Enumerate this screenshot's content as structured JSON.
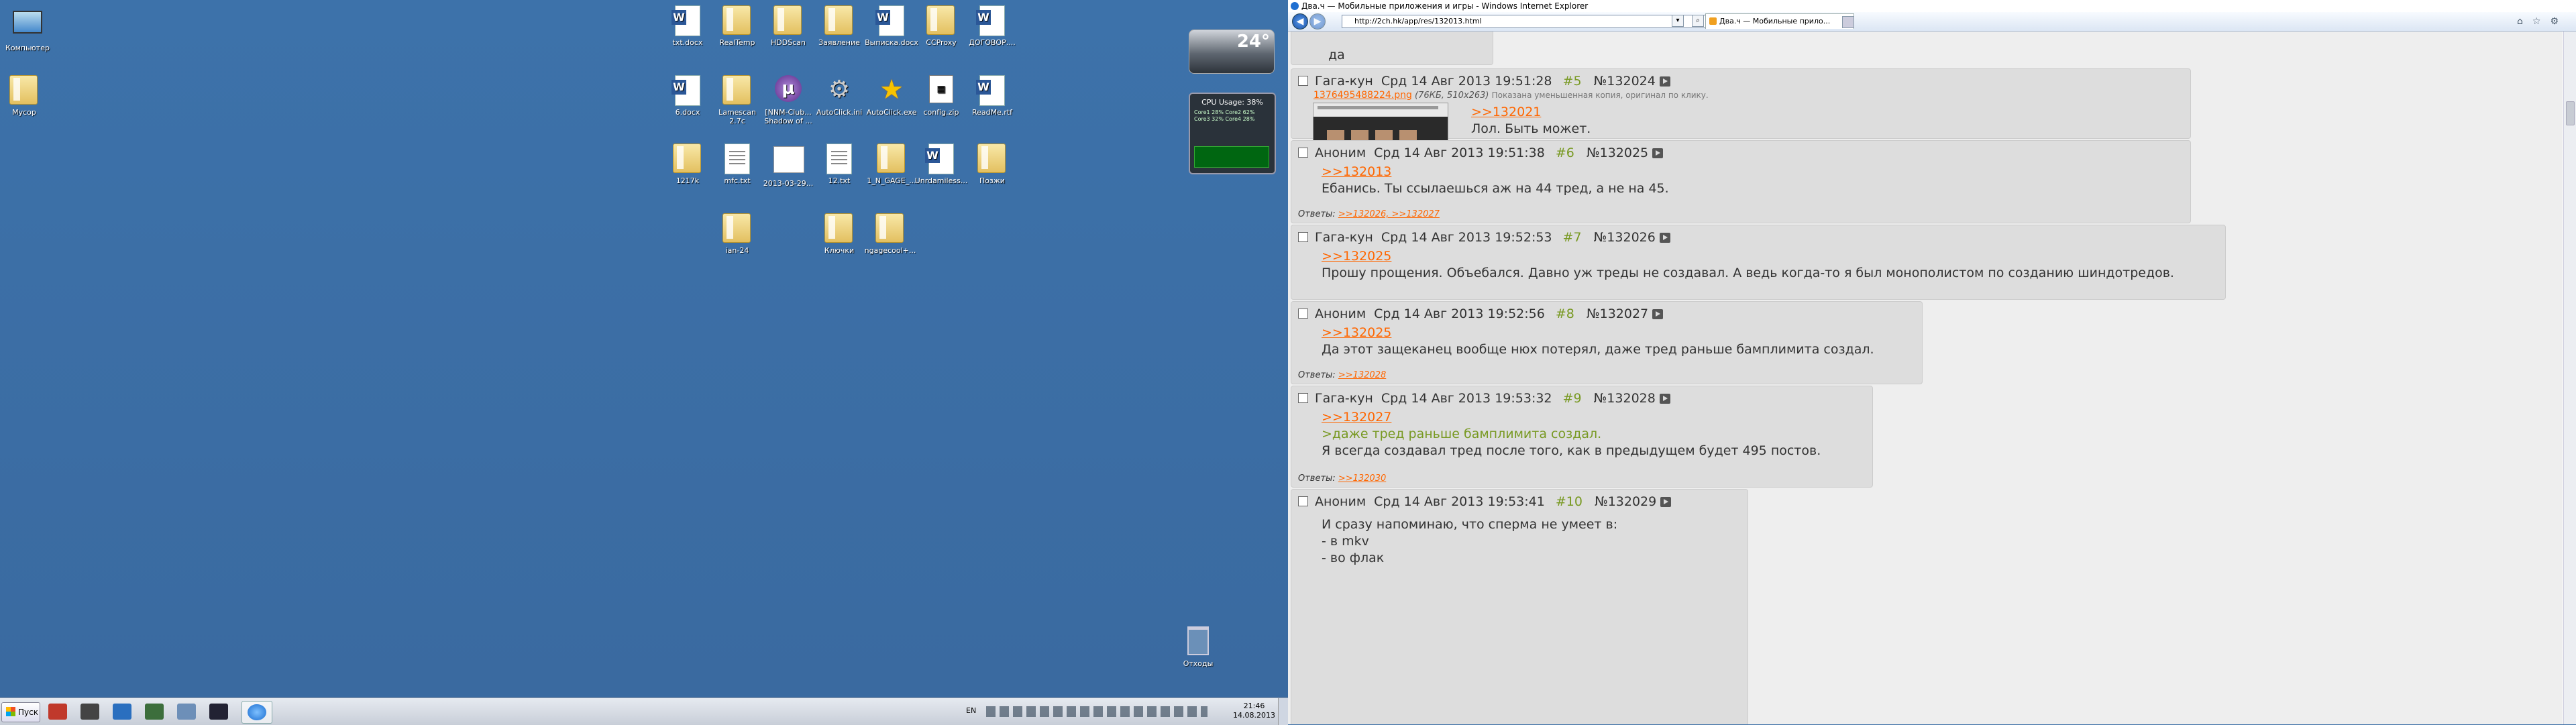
{
  "desktop": {
    "icons": [
      {
        "label": "Компьютер"
      },
      {
        "label": "Мусор"
      },
      {
        "label": "txt.docx"
      },
      {
        "label": "RealTemp"
      },
      {
        "label": "HDDScan"
      },
      {
        "label": "Заявление"
      },
      {
        "label": "Выписка.docx"
      },
      {
        "label": "CCProxy"
      },
      {
        "label": "ДОГОВОР...."
      },
      {
        "label": "6.docx"
      },
      {
        "label": "Lamescan 2.7c"
      },
      {
        "label": "[NNM-Club... Shadow of ..."
      },
      {
        "label": "AutoClick.ini"
      },
      {
        "label": "AutoClick.exe"
      },
      {
        "label": "config.zip"
      },
      {
        "label": "ReadMe.rtf"
      },
      {
        "label": "1217k"
      },
      {
        "label": "mfc.txt"
      },
      {
        "label": "2013-03-29..."
      },
      {
        "label": "12.txt"
      },
      {
        "label": "1_N_GAGE_..."
      },
      {
        "label": "Unrdamiless..."
      },
      {
        "label": "Позжи"
      },
      {
        "label": "ian-24"
      },
      {
        "label": "Ключки"
      },
      {
        "label": "ngagecool+..."
      },
      {
        "label": "Отходы"
      }
    ],
    "weather_temp": "24°",
    "cpu_gadget": {
      "title": "CPU Usage: 38%",
      "cores": "Core1 28% Core2 62% Core3 32% Core4 28%"
    }
  },
  "taskbar": {
    "start_label": "Пуск",
    "lang": "EN",
    "time": "21:46",
    "date": "14.08.2013"
  },
  "browser": {
    "title": "Два.ч — Мобильные приложения и игры - Windows Internet Explorer",
    "address": "http://2ch.hk/app/res/132013.html",
    "tab_label": "Два.ч — Мобильные прило..."
  },
  "posts": [
    {
      "lines": [
        "да"
      ]
    },
    {
      "name": "Гага-кун",
      "date": "Срд 14 Авг 2013 19:51:28",
      "index": "#5",
      "num": "№132024",
      "file": {
        "name": "1376495488224.png",
        "meta": "(76КБ, 510x263)",
        "note": "Показана уменьшенная копия, оригинал по клику."
      },
      "reply_link": ">>132021",
      "lines": [
        "Лол. Быть может."
      ]
    },
    {
      "name": "Аноним",
      "date": "Срд 14 Авг 2013 19:51:38",
      "index": "#6",
      "num": "№132025",
      "reply_link": ">>132013",
      "lines": [
        "Ебанись. Ты ссылаешься аж на 44 тред, а не на 45."
      ],
      "answers_label": "Ответы:",
      "answers": ">>132026, >>132027"
    },
    {
      "name": "Гага-кун",
      "date": "Срд 14 Авг 2013 19:52:53",
      "index": "#7",
      "num": "№132026",
      "reply_link": ">>132025",
      "lines": [
        "Прошу прощения. Объебался. Давно уж треды не создавал. А ведь когда-то я был монополистом по созданию шиндотредов."
      ]
    },
    {
      "name": "Аноним",
      "date": "Срд 14 Авг 2013 19:52:56",
      "index": "#8",
      "num": "№132027",
      "reply_link": ">>132025",
      "lines": [
        "Да этот защеканец вообще нюх потерял, даже тред раньше бамплимита создал."
      ],
      "answers_label": "Ответы:",
      "answers": ">>132028"
    },
    {
      "name": "Гага-кун",
      "date": "Срд 14 Авг 2013 19:53:32",
      "index": "#9",
      "num": "№132028",
      "reply_link": ">>132027",
      "quote": ">даже тред раньше бамплимита создал.",
      "lines": [
        "Я всегда создавал тред после того, как в предыдущем будет 495 постов."
      ],
      "answers_label": "Ответы:",
      "answers": ">>132030"
    },
    {
      "name": "Аноним",
      "date": "Срд 14 Авг 2013 19:53:41",
      "index": "#10",
      "num": "№132029",
      "lines": [
        "И сразу напоминаю, что сперма не умеет в:",
        "- в mkv",
        "- во флак"
      ]
    }
  ]
}
